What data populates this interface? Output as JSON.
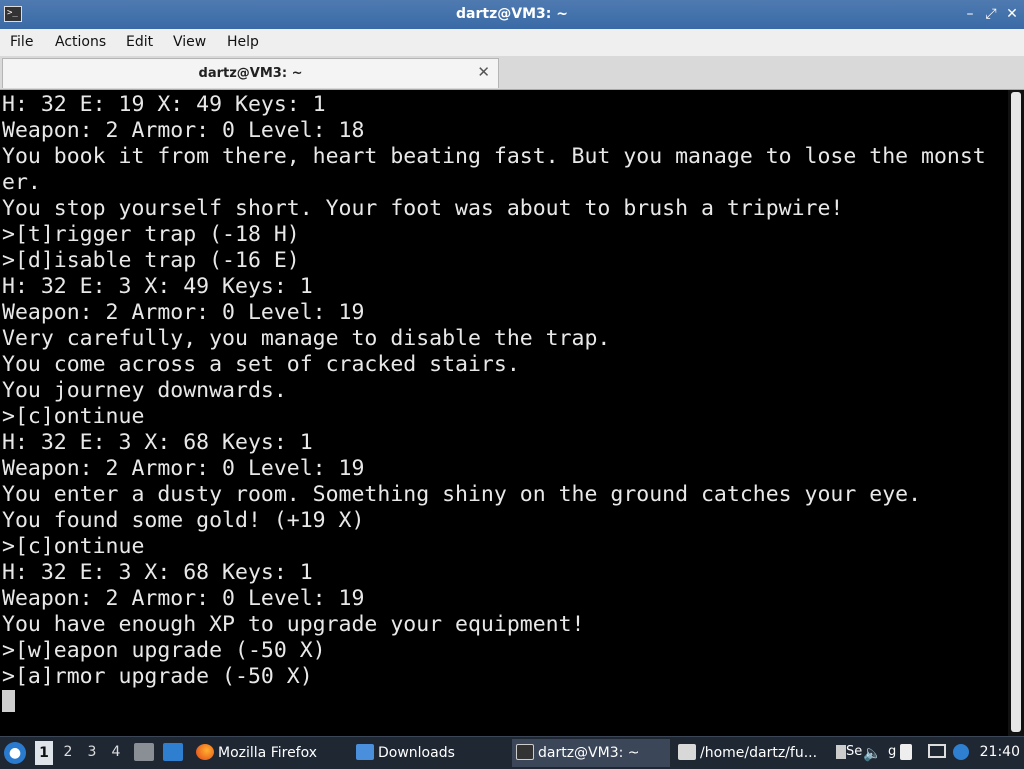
{
  "window": {
    "title": "dartz@VM3: ~"
  },
  "menu": {
    "items": [
      "File",
      "Actions",
      "Edit",
      "View",
      "Help"
    ]
  },
  "tab": {
    "label": "dartz@VM3: ~"
  },
  "terminal": {
    "lines": [
      "H: 32 E: 19 X: 49 Keys: 1",
      "Weapon: 2 Armor: 0 Level: 18",
      "You book it from there, heart beating fast. But you manage to lose the monst",
      "er.",
      "You stop yourself short. Your foot was about to brush a tripwire!",
      ">[t]rigger trap (-18 H)",
      ">[d]isable trap (-16 E)",
      "H: 32 E: 3 X: 49 Keys: 1",
      "Weapon: 2 Armor: 0 Level: 19",
      "Very carefully, you manage to disable the trap.",
      "You come across a set of cracked stairs.",
      "You journey downwards.",
      ">[c]ontinue",
      "H: 32 E: 3 X: 68 Keys: 1",
      "Weapon: 2 Armor: 0 Level: 19",
      "You enter a dusty room. Something shiny on the ground catches your eye.",
      "You found some gold! (+19 X)",
      ">[c]ontinue",
      "H: 32 E: 3 X: 68 Keys: 1",
      "Weapon: 2 Armor: 0 Level: 19",
      "You have enough XP to upgrade your equipment!",
      ">[w]eapon upgrade (-50 X)",
      ">[a]rmor upgrade (-50 X)"
    ]
  },
  "taskbar": {
    "workspaces": [
      "1",
      "2",
      "3",
      "4"
    ],
    "active_workspace": "1",
    "tasks": {
      "firefox": "Mozilla Firefox",
      "downloads": "Downloads",
      "terminal": "dartz@VM3: ~",
      "editor": "/home/dartz/fu..."
    },
    "tray": {
      "se": "Se",
      "g": "g"
    },
    "clock": "21:40"
  },
  "icons": {
    "app": "terminal-icon",
    "minimize": "minimize-icon",
    "maximize": "maximize-icon",
    "close": "close-icon",
    "tab_close": "tab-close-icon"
  },
  "colors": {
    "titlebar": "#3a6aa6",
    "terminal_bg": "#000000",
    "terminal_fg": "#e8e8e8",
    "taskbar": "#1f2733"
  }
}
